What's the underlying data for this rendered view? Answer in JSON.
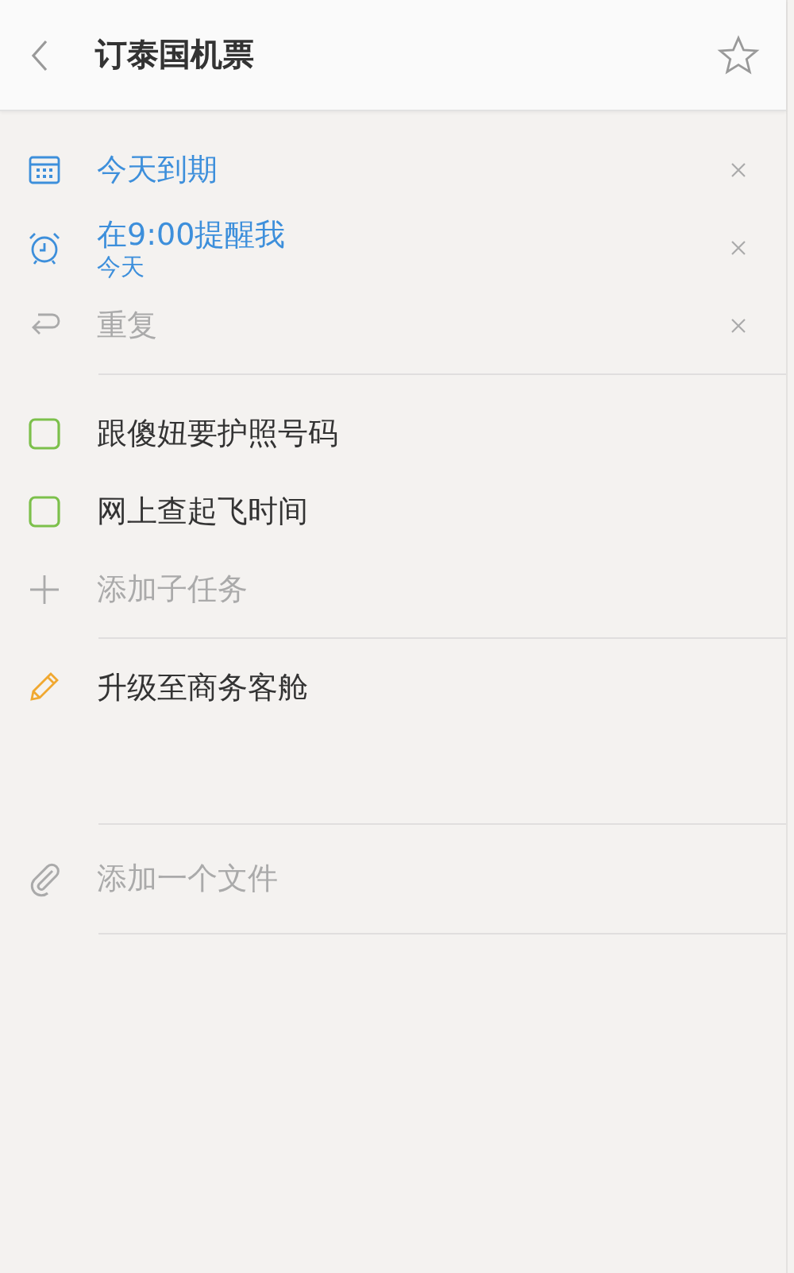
{
  "header": {
    "title": "订泰国机票",
    "starred": false
  },
  "dates": [
    {
      "kind": "due",
      "label": "今天到期",
      "active": true
    },
    {
      "kind": "reminder",
      "label": "在9:00提醒我",
      "sublabel": "今天",
      "active": true
    },
    {
      "kind": "repeat",
      "label": "重复",
      "active": false
    }
  ],
  "subtasks": [
    {
      "label": "跟傻妞要护照号码",
      "checked": false
    },
    {
      "label": "网上查起飞时间",
      "checked": false
    }
  ],
  "add_subtask": {
    "placeholder": "添加子任务"
  },
  "note": "升级至商务客舱",
  "add_file": {
    "label": "添加一个文件"
  }
}
